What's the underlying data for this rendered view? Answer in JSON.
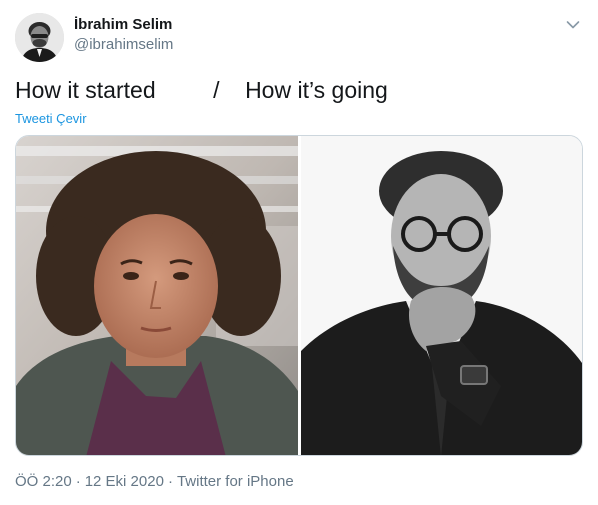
{
  "author": {
    "display_name": "İbrahim Selim",
    "handle": "@ibrahimselim"
  },
  "tweet": {
    "text": "How it started         /    How it’s going",
    "translate_label": "Tweeti Çevir"
  },
  "media": {
    "count": 2
  },
  "meta": {
    "time": "ÖÖ 2:20",
    "date": "12 Eki 2020",
    "source": "Twitter for iPhone",
    "separator": "·"
  },
  "colors": {
    "link": "#1b95e0",
    "secondary_text": "#657786",
    "border": "#ccd6dd"
  }
}
